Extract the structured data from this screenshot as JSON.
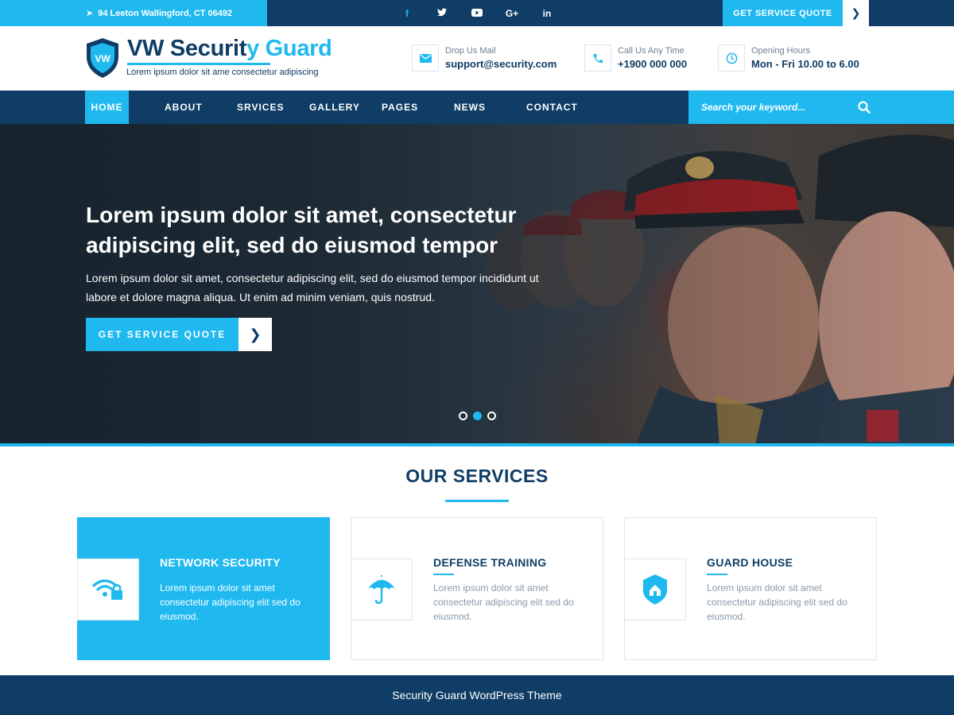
{
  "topbar": {
    "address": "94 Leeton Wallingford, CT 06492",
    "social": [
      "f",
      "twitter",
      "youtube",
      "G+",
      "in"
    ],
    "quote_label": "GET SERVICE QUOTE"
  },
  "header": {
    "logo_badge": "VW",
    "logo_main": "VW Securit",
    "logo_accent": "y Guard",
    "tagline": "Lorem ipsum dolor sit ame consectetur adipiscing",
    "mail_label": "Drop Us Mail",
    "mail_value": "support@security.com",
    "call_label": "Call Us Any Time",
    "call_value": "+1900 000 000",
    "hours_label": "Opening Hours",
    "hours_value": "Mon - Fri 10.00 to 6.00"
  },
  "nav": {
    "items": [
      "HOME",
      "ABOUT",
      "SRVICES",
      "GALLERY",
      "PAGES",
      "NEWS",
      "CONTACT"
    ],
    "active": "HOME",
    "search_placeholder": "Search your keyword..."
  },
  "hero": {
    "title": "Lorem ipsum dolor sit amet, consectetur adipiscing elit, sed do eiusmod tempor",
    "text": "Lorem ipsum dolor sit amet, consectetur adipiscing elit, sed do eiusmod tempor incididunt ut labore et dolore magna aliqua. Ut enim ad minim veniam, quis nostrud.",
    "button_label": "GET SERVICE QUOTE",
    "slides": 3,
    "active_slide": 2
  },
  "services": {
    "title": "OUR SERVICES",
    "cards": [
      {
        "title": "NETWORK SECURITY",
        "text": "Lorem ipsum dolor sit amet consectetur adipiscing elit sed do eiusmod.",
        "icon": "wifi-lock-icon",
        "active": true
      },
      {
        "title": "DEFENSE TRAINING",
        "text": "Lorem ipsum dolor sit amet consectetur adipiscing elit sed do eiusmod.",
        "icon": "umbrella-icon",
        "active": false
      },
      {
        "title": "GUARD HOUSE",
        "text": "Lorem ipsum dolor sit amet consectetur adipiscing elit sed do eiusmod.",
        "icon": "shield-home-icon",
        "active": false
      }
    ]
  },
  "footer": {
    "text": "Security Guard WordPress Theme"
  },
  "colors": {
    "navy": "#0f3d66",
    "accent": "#1fb9f0"
  }
}
